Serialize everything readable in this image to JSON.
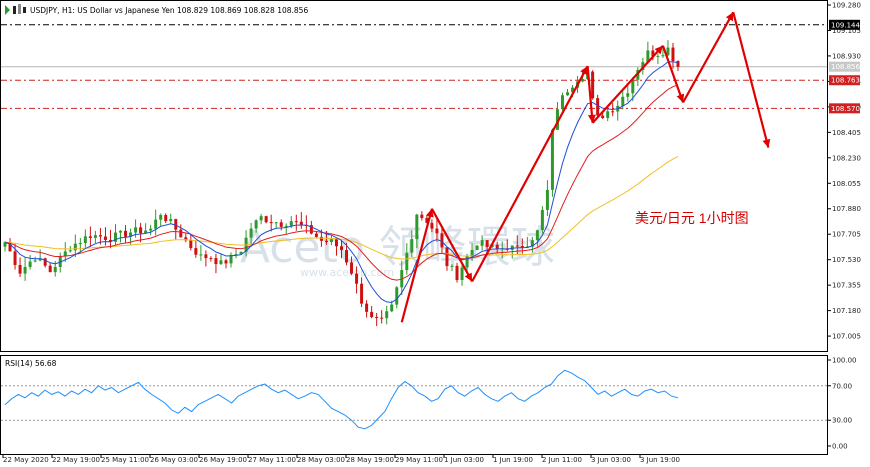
{
  "header": {
    "symbol_line": "USDJPY, H1:  US Dollar vs Japanese Yen  108.829 108.869 108.828 108.856"
  },
  "annotation": "美元/日元 1小时图",
  "watermark": {
    "text": "Aceto 领峰環球",
    "url": "www.acetop.com"
  },
  "colors": {
    "bull": "#2e9a2e",
    "bear": "#d01010",
    "ma_fast": "#1f4fd6",
    "ma_mid": "#e21f1f",
    "ma_slow": "#f0c020",
    "rsi": "#1e90ff",
    "forecast": "#e00000",
    "level": "#d22020"
  },
  "chart_data": [
    {
      "type": "candlestick",
      "title": "USDJPY, H1:  US Dollar vs Japanese Yen",
      "ylim": [
        106.93,
        109.28
      ],
      "yticks": [
        "109.280",
        "109.105",
        "108.930",
        "108.755",
        "108.580",
        "108.405",
        "108.230",
        "108.055",
        "107.880",
        "107.705",
        "107.530",
        "107.355",
        "107.180",
        "107.005"
      ],
      "xlabels": [
        "22 May 2020",
        "22 May 19:00",
        "25 May 11:00",
        "26 May 03:00",
        "26 May 19:00",
        "27 May 11:00",
        "28 May 03:00",
        "28 May 19:00",
        "29 May 11:00",
        "1 Jun 03:00",
        "1 Jun 19:00",
        "2 Jun 11:00",
        "3 Jun 03:00",
        "3 Jun 19:00"
      ],
      "current_price": "108.856",
      "price_levels": [
        {
          "label": "109.144",
          "value": 109.144,
          "style": "dash-dot",
          "color": "black"
        },
        {
          "label": "108.763",
          "value": 108.763,
          "style": "dash-dot",
          "color": "red"
        },
        {
          "label": "108.570",
          "value": 108.57,
          "style": "dash-dot",
          "color": "red"
        }
      ],
      "close_path": [
        [
          0,
          107.65
        ],
        [
          3,
          107.45
        ],
        [
          6,
          107.55
        ],
        [
          9,
          107.45
        ],
        [
          13,
          107.62
        ],
        [
          17,
          107.7
        ],
        [
          21,
          107.68
        ],
        [
          25,
          107.72
        ],
        [
          29,
          107.74
        ],
        [
          31,
          107.85
        ],
        [
          33,
          107.78
        ],
        [
          35,
          107.7
        ],
        [
          37,
          107.62
        ],
        [
          39,
          107.55
        ],
        [
          41,
          107.55
        ],
        [
          43,
          107.5
        ],
        [
          45,
          107.54
        ],
        [
          47,
          107.6
        ],
        [
          49,
          107.75
        ],
        [
          51,
          107.82
        ],
        [
          53,
          107.8
        ],
        [
          55,
          107.78
        ],
        [
          57,
          107.8
        ],
        [
          59,
          107.76
        ],
        [
          61,
          107.72
        ],
        [
          63,
          107.66
        ],
        [
          65,
          107.65
        ],
        [
          67,
          107.6
        ],
        [
          69,
          107.45
        ],
        [
          71,
          107.25
        ],
        [
          73,
          107.12
        ],
        [
          75,
          107.1
        ],
        [
          77,
          107.2
        ],
        [
          79,
          107.45
        ],
        [
          81,
          107.7
        ],
        [
          82,
          107.85
        ],
        [
          84,
          107.8
        ],
        [
          86,
          107.7
        ],
        [
          88,
          107.5
        ],
        [
          90,
          107.42
        ],
        [
          92,
          107.55
        ],
        [
          94,
          107.65
        ],
        [
          96,
          107.62
        ],
        [
          98,
          107.6
        ],
        [
          100,
          107.62
        ],
        [
          102,
          107.6
        ],
        [
          104,
          107.65
        ],
        [
          106,
          107.72
        ],
        [
          108,
          108.0
        ],
        [
          109,
          108.4
        ],
        [
          110,
          108.58
        ],
        [
          112,
          108.7
        ],
        [
          114,
          108.78
        ],
        [
          116,
          108.82
        ],
        [
          117,
          108.62
        ],
        [
          118,
          108.5
        ],
        [
          120,
          108.55
        ],
        [
          122,
          108.6
        ],
        [
          124,
          108.7
        ],
        [
          126,
          108.85
        ],
        [
          128,
          108.95
        ],
        [
          130,
          108.95
        ],
        [
          132,
          108.98
        ],
        [
          134,
          108.86
        ]
      ],
      "forecast_path": [
        [
          79,
          107.1
        ],
        [
          85,
          107.88
        ],
        [
          93,
          107.38
        ],
        [
          116,
          108.86
        ],
        [
          117,
          108.47
        ],
        [
          131,
          109.0
        ],
        [
          135,
          108.61
        ],
        [
          145,
          109.23
        ],
        [
          152,
          108.3
        ]
      ],
      "ma_slow_endpoint": [
        134,
        108.24
      ]
    },
    {
      "type": "line",
      "title": "RSI(14) 56.68",
      "ylim": [
        0,
        100
      ],
      "yticks": [
        "100.00",
        "70.00",
        "30.00",
        "0.00"
      ],
      "levels": [
        70,
        30
      ],
      "values": [
        48,
        55,
        60,
        56,
        62,
        58,
        65,
        60,
        63,
        58,
        64,
        60,
        66,
        62,
        70,
        65,
        68,
        62,
        66,
        70,
        74,
        66,
        60,
        55,
        50,
        42,
        38,
        45,
        40,
        48,
        52,
        56,
        60,
        55,
        50,
        58,
        62,
        66,
        70,
        72,
        66,
        62,
        65,
        60,
        55,
        58,
        62,
        60,
        52,
        44,
        40,
        36,
        30,
        22,
        20,
        24,
        32,
        40,
        55,
        68,
        75,
        70,
        62,
        58,
        52,
        55,
        66,
        70,
        62,
        58,
        64,
        68,
        60,
        55,
        52,
        58,
        62,
        55,
        52,
        58,
        62,
        68,
        72,
        82,
        88,
        85,
        80,
        76,
        68,
        60,
        64,
        58,
        62,
        66,
        60,
        58,
        64,
        66,
        62,
        64,
        58,
        56
      ]
    }
  ]
}
